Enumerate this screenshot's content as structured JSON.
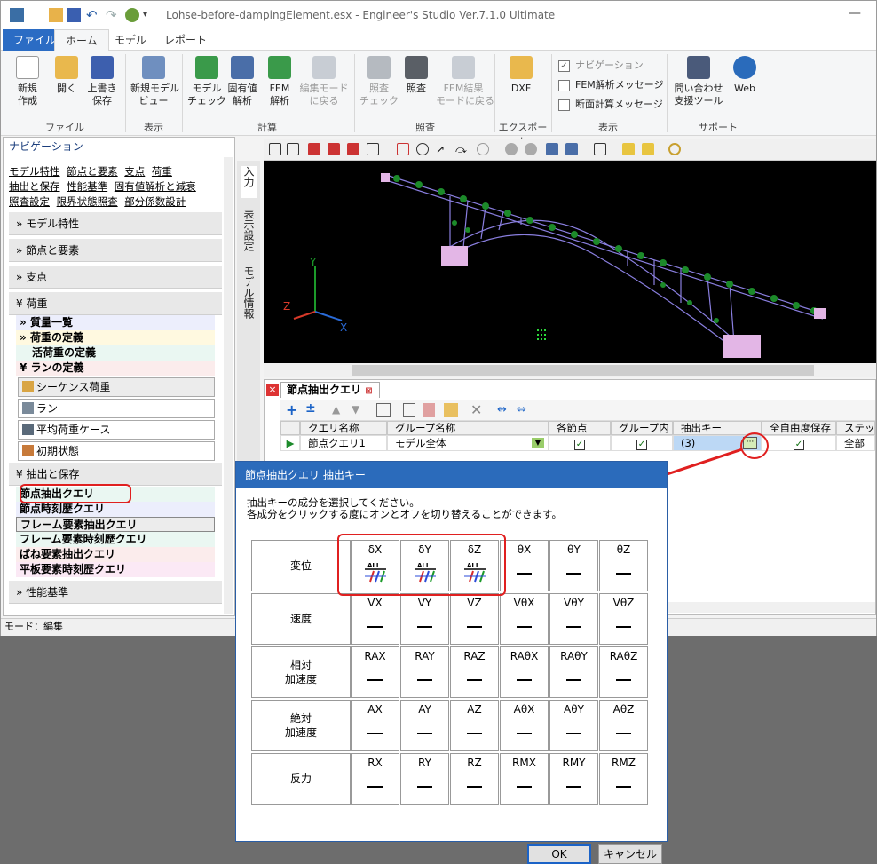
{
  "window": {
    "title": "Lohse-before-dampingElement.esx - Engineer's Studio Ver.7.1.0 Ultimate"
  },
  "ribbon": {
    "tabs": [
      "ファイル",
      "ホーム",
      "モデル",
      "レポート"
    ],
    "buttons": {
      "new": "新規\n作成",
      "open": "開く",
      "save": "上書き\n保存",
      "newmodelview": "新規モデル\nビュー",
      "modelcheck": "モデル\nチェック",
      "eigen": "固有値\n解析",
      "fem": "FEM\n解析",
      "backtoedit": "編集モード\nに戻る",
      "verifycheck": "照査\nチェック",
      "verify": "照査",
      "femresult": "FEM結果\nモードに戻る",
      "dxf": "DXF",
      "support": "問い合わせ\n支援ツール",
      "web": "Web"
    },
    "checks": {
      "navigation": "ナビゲーション",
      "femmsg": "FEM解析メッセージ",
      "sectionmsg": "断面計算メッセージ"
    },
    "groups": [
      "ファイル",
      "表示",
      "計算",
      "照査",
      "エクスポート",
      "表示",
      "サポート"
    ]
  },
  "nav": {
    "title": "ナビゲーション",
    "links": [
      [
        "モデル特性",
        "節点と要素",
        "支点",
        "荷重"
      ],
      [
        "抽出と保存",
        "性能基準",
        "固有値解析と減衰"
      ],
      [
        "照査設定",
        "限界状態照査",
        "部分係数設計"
      ]
    ],
    "sections": {
      "model": "モデル特性",
      "nodes": "節点と要素",
      "support": "支点",
      "load": "荷重",
      "extract": "抽出と保存",
      "perf": "性能基準"
    },
    "load_items": [
      "質量一覧",
      "荷重の定義",
      "活荷重の定義",
      "ランの定義"
    ],
    "run_items": [
      "シーケンス荷重",
      "ラン",
      "平均荷重ケース",
      "初期状態"
    ],
    "extract_items": [
      "節点抽出クエリ",
      "節点時刻歴クエリ",
      "フレーム要素抽出クエリ",
      "フレーム要素時刻歴クエリ",
      "ばね要素抽出クエリ",
      "平板要素時刻歴クエリ"
    ]
  },
  "vtabs": [
    "入力",
    "表示設定",
    "モデル情報"
  ],
  "query": {
    "tab": "節点抽出クエリ",
    "headers": [
      "クエリ名称",
      "グループ名称",
      "各節点",
      "グループ内",
      "抽出キー",
      "全自由度保存",
      "ステップ"
    ],
    "row": {
      "name": "節点クエリ1",
      "group": "モデル全体",
      "key": "(3)",
      "steps": "全部"
    }
  },
  "status": "モード：編集",
  "dialog": {
    "title": "節点抽出クエリ 抽出キー",
    "instruction_1": "抽出キーの成分を選択してください。",
    "instruction_2": "各成分をクリックする度にオンとオフを切り替えることができます。",
    "rows": [
      {
        "label": "変位",
        "cells": [
          "δX",
          "δY",
          "δZ",
          "θX",
          "θY",
          "θZ"
        ]
      },
      {
        "label": "速度",
        "cells": [
          "VX",
          "VY",
          "VZ",
          "VθX",
          "VθY",
          "VθZ"
        ]
      },
      {
        "label": "相対\n加速度",
        "cells": [
          "RAX",
          "RAY",
          "RAZ",
          "RAθX",
          "RAθY",
          "RAθZ"
        ]
      },
      {
        "label": "絶対\n加速度",
        "cells": [
          "AX",
          "AY",
          "AZ",
          "AθX",
          "AθY",
          "AθZ"
        ]
      },
      {
        "label": "反力",
        "cells": [
          "RX",
          "RY",
          "RZ",
          "RMX",
          "RMY",
          "RMZ"
        ]
      }
    ],
    "selected": [
      [
        true,
        true,
        true,
        false,
        false,
        false
      ],
      [
        false,
        false,
        false,
        false,
        false,
        false
      ],
      [
        false,
        false,
        false,
        false,
        false,
        false
      ],
      [
        false,
        false,
        false,
        false,
        false,
        false
      ],
      [
        false,
        false,
        false,
        false,
        false,
        false
      ]
    ],
    "all_badge": "ALL",
    "ok": "OK",
    "cancel": "キャンセル"
  },
  "axes": {
    "x": "X",
    "y": "Y",
    "z": "Z"
  },
  "colors": {
    "accent": "#2b6bbb",
    "highlight": "#e02020",
    "grid_selected": "#bcd8f5"
  }
}
